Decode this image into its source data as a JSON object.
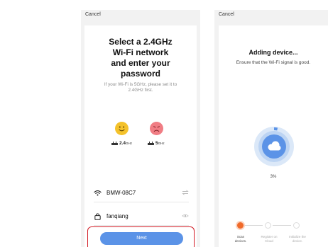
{
  "left_screen": {
    "cancel": "Cancel",
    "title_lines": [
      "Select a 2.4GHz",
      "Wi-Fi network",
      "and enter your",
      "password"
    ],
    "hint_lines": [
      "If your Wi-Fi is 5GHz, please set it to",
      "2.4GHz first."
    ],
    "band_24": {
      "main": "2.4",
      "sub": "GHz",
      "icon": "smile-icon",
      "color": "#f4c22b"
    },
    "band_5": {
      "main": "5",
      "sub": "GHz",
      "icon": "sad-icon",
      "color": "#f07d84"
    },
    "ssid": {
      "value": "BMW-08C7",
      "icon": "wifi-icon",
      "trailing_icon": "switch-icon"
    },
    "password": {
      "value": "fanqiang",
      "icon": "lock-icon",
      "trailing_icon": "eye-icon"
    },
    "next_label": "Next",
    "accent": "#5b93e7",
    "highlight_color": "#d21a24"
  },
  "right_screen": {
    "cancel": "Cancel",
    "title": "Adding device...",
    "subtitle": "Ensure that the Wi-Fi signal is good.",
    "progress": 0.03,
    "progress_label": "3%",
    "steps": [
      {
        "lines": [
          "Scan",
          "devices."
        ],
        "active": true
      },
      {
        "lines": [
          "Register on",
          "Cloud"
        ],
        "active": false
      },
      {
        "lines": [
          "Initialize the",
          "device."
        ],
        "active": false
      }
    ],
    "accent": "#f06a2a"
  }
}
